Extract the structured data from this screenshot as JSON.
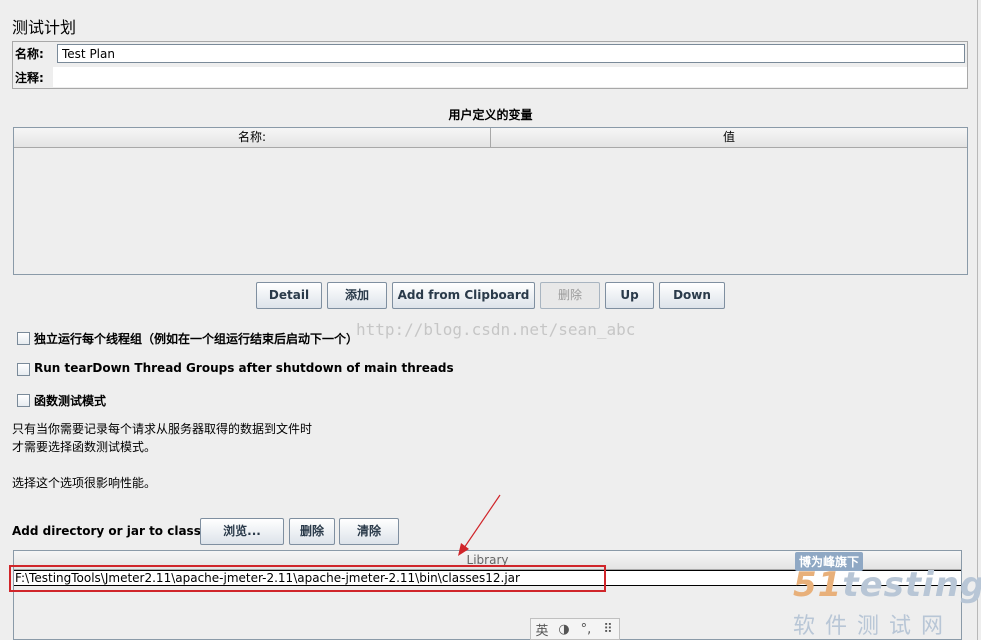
{
  "panel": {
    "title": "测试计划",
    "name_label": "名称:",
    "name_value": "Test Plan",
    "comment_label": "注释:",
    "comment_value": ""
  },
  "variables": {
    "title": "用户定义的变量",
    "columns": [
      "名称:",
      "值"
    ]
  },
  "buttons": {
    "detail": "Detail",
    "add": "添加",
    "add_clipboard": "Add from Clipboard",
    "delete": "删除",
    "up": "Up",
    "down": "Down"
  },
  "options": {
    "independent_threads": "独立运行每个线程组（例如在一个组运行结束后启动下一个）",
    "teardown": "Run tearDown Thread Groups after shutdown of main threads",
    "functional_mode": "函数测试模式"
  },
  "notes": {
    "line1": "只有当你需要记录每个请求从服务器取得的数据到文件时",
    "line2": "才需要选择函数测试模式。",
    "line3": "选择这个选项很影响性能。"
  },
  "classpath": {
    "label": "Add directory or jar to classpath",
    "browse": "浏览...",
    "delete": "删除",
    "clear": "清除",
    "column": "Library",
    "rows": [
      "F:\\TestingTools\\Jmeter2.11\\apache-jmeter-2.11\\apache-jmeter-2.11\\bin\\classes12.jar"
    ]
  },
  "watermark": "http://blog.csdn.net/sean_abc",
  "logo": {
    "tag": "博为峰旗下",
    "brand_num": "51",
    "brand_word": "testing",
    "sub": "软件测试网"
  },
  "ime": [
    "英",
    "◑",
    "°,",
    "⠿"
  ],
  "colors": {
    "highlight": "#d0252a",
    "background": "#eeeeee"
  }
}
